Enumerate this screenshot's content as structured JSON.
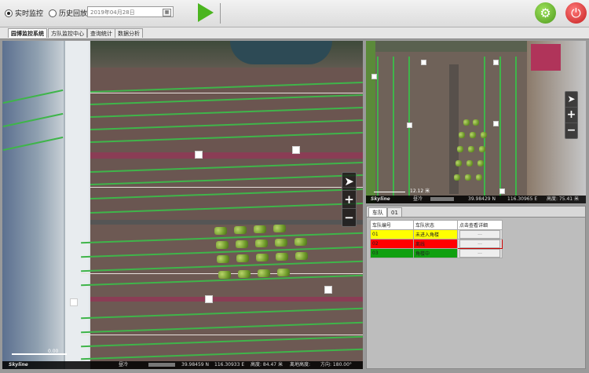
{
  "toolbar": {
    "mode_realtime": "实时监控",
    "mode_history": "历史回放",
    "date_value": "2019年04月28日"
  },
  "tabs": [
    "园博监控系统",
    "方队监控中心",
    "查询统计",
    "数据分析"
  ],
  "main_map": {
    "status": {
      "brand": "Skyline",
      "weather": "昼冷",
      "lat": "39.98459 N",
      "lon": "116.30933 E",
      "altitude": "高度: 84.47 米",
      "ground_altitude": "离地高度:",
      "direction": "方向: 180.00°"
    },
    "scale_label": "0.00"
  },
  "mini_map": {
    "status": {
      "brand": "Skyline",
      "weather": "昼冷",
      "lat": "39.98429 N",
      "lon": "116.30965 E",
      "altitude": "高度: 75.41 米"
    },
    "scale_label": "12.12 米"
  },
  "panel": {
    "tabs": [
      "车队",
      "01"
    ],
    "columns": [
      "车队编号",
      "车队状态",
      "点击查看详细"
    ],
    "rows": [
      {
        "id": "01",
        "status": "未进入角楼",
        "detail": "...",
        "color": "#ffff00"
      },
      {
        "id": "02",
        "status": "离线",
        "detail": "...",
        "color": "#ff0000"
      },
      {
        "id": "03",
        "status": "角楼中",
        "detail": "...",
        "color": "#10a010"
      }
    ]
  },
  "colors": {
    "play": "#4bb51f",
    "settings": "#6cc32a",
    "power": "#e13b3b"
  },
  "icons": [
    "play-icon",
    "gear-icon",
    "power-icon",
    "calendar-icon",
    "compass-icon",
    "zoom-in-icon",
    "zoom-out-icon"
  ]
}
